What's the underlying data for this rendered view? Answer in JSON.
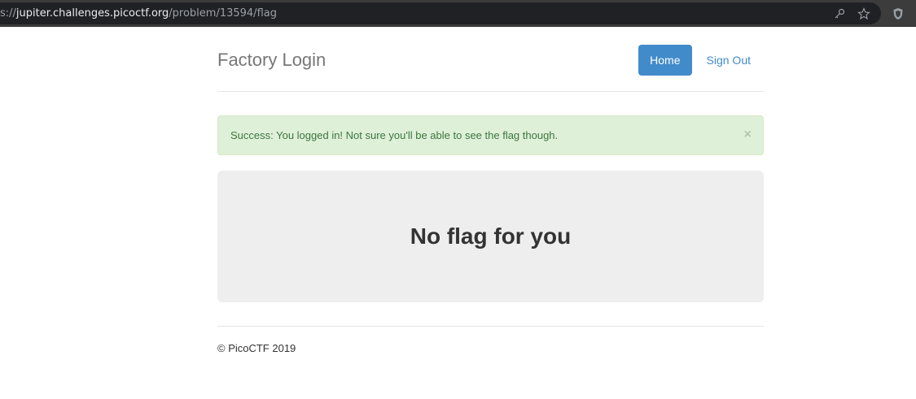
{
  "browser": {
    "url_scheme": "s://",
    "url_host": "jupiter.challenges.picoctf.org",
    "url_path": "/problem/13594/flag"
  },
  "header": {
    "brand": "Factory Login",
    "nav": {
      "home": "Home",
      "sign_out": "Sign Out"
    }
  },
  "alert": {
    "message": "Success: You logged in! Not sure you'll be able to see the flag though.",
    "close": "×"
  },
  "jumbotron": {
    "heading": "No flag for you"
  },
  "footer": {
    "text": "© PicoCTF 2019"
  },
  "colors": {
    "primary": "#428bca",
    "alert_bg": "#dff0d8",
    "alert_text": "#3c763d",
    "jumbotron_bg": "#eeeeee"
  }
}
